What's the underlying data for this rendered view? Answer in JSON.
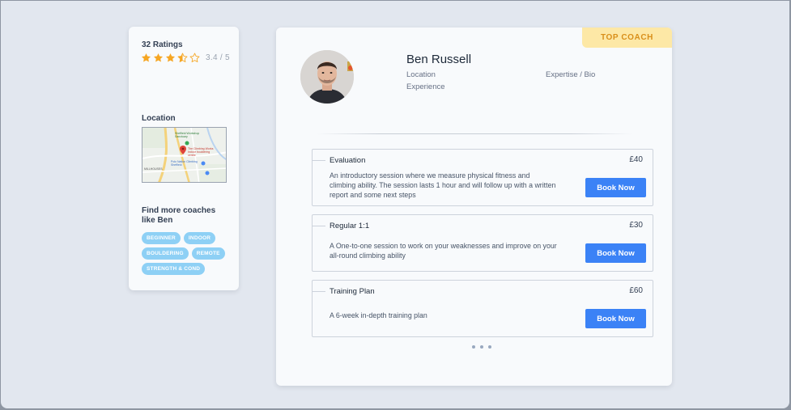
{
  "sidebar": {
    "ratings_title": "32 Ratings",
    "rating_value": "3.4 / 5",
    "rating_stars": 3.5,
    "rating_max": 5,
    "star_color": "#f6a623",
    "location_title": "Location",
    "find_title": "Find more coaches like Ben",
    "tags": [
      "BEGINNER",
      "INDOOR",
      "BOULDERING",
      "REMOTE",
      "STRENGTH & COND"
    ]
  },
  "map": {
    "label_top": "Sheffield Workshop Sanctuary",
    "label_pin": "The Climbing Works Indoor bouldering centre",
    "label_mid": "Polo Nation Climbing Sheffield",
    "label_left": "MILLHOUSES"
  },
  "profile": {
    "badge": "TOP COACH",
    "name": "Ben Russell",
    "location_label": "Location",
    "experience_label": "Experience",
    "expertise_label": "Expertise / Bio"
  },
  "sessions": [
    {
      "title": "Evaluation",
      "price": "£40",
      "description": "An introductory session where we measure physical fitness and climbing ability. The session lasts 1 hour and will follow up with a written report and some next steps",
      "button": "Book Now"
    },
    {
      "title": "Regular 1:1",
      "price": "£30",
      "description": "A One-to-one session to work on your weaknesses and improve on your all-round climbing ability",
      "button": "Book Now"
    },
    {
      "title": "Training Plan",
      "price": "£60",
      "description": "A 6-week in-depth training plan",
      "button": "Book Now"
    }
  ],
  "colors": {
    "accent": "#3b82f6",
    "tag": "#8ed0f5",
    "badge_bg": "#fde8a6",
    "badge_text": "#d98f1a"
  }
}
